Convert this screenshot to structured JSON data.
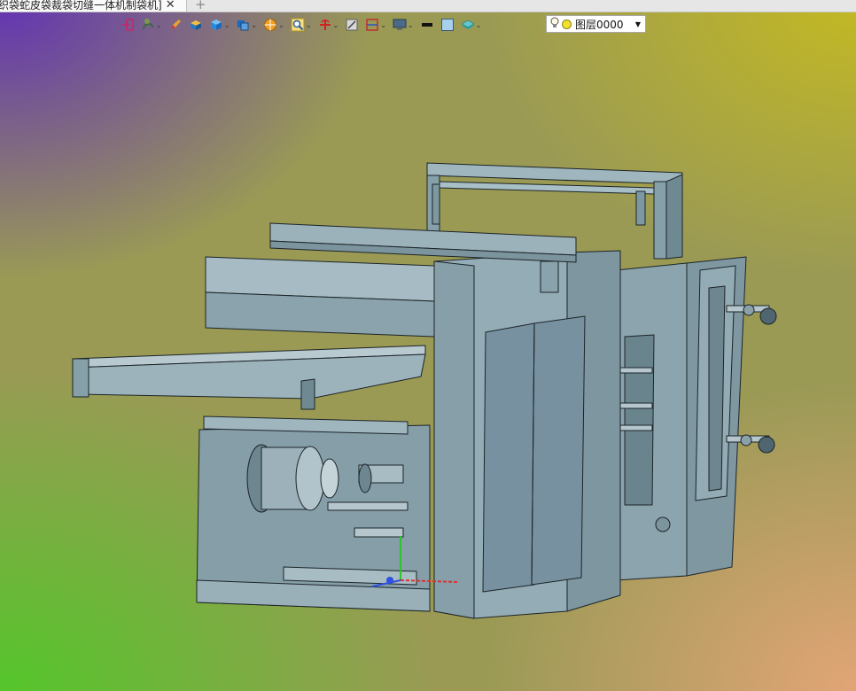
{
  "document_tab": {
    "title": "织袋蛇皮袋裁袋切缝一体机制袋机]",
    "close_symbol": "✕",
    "new_tab_symbol": "+"
  },
  "toolbar": {
    "tools": [
      {
        "icon": "exit-sketch-icon",
        "has_dropdown": false
      },
      {
        "icon": "spiral-curve-icon",
        "has_dropdown": true
      },
      {
        "icon": "pencil-icon",
        "has_dropdown": false
      },
      {
        "icon": "solid-box-icon",
        "has_dropdown": false
      },
      {
        "icon": "cube-icon",
        "has_dropdown": true
      },
      {
        "icon": "view-cube-icon",
        "has_dropdown": true
      },
      {
        "icon": "render-style-icon",
        "has_dropdown": true
      },
      {
        "icon": "zoom-fit-icon",
        "has_dropdown": true
      },
      {
        "icon": "pivot-icon",
        "has_dropdown": true
      },
      {
        "icon": "clip-plane-icon",
        "has_dropdown": false
      },
      {
        "icon": "section-view-icon",
        "has_dropdown": true
      },
      {
        "icon": "display-icon",
        "has_dropdown": true
      },
      {
        "icon": "line-weight-icon",
        "has_dropdown": false
      },
      {
        "icon": "color-swatch-icon",
        "has_dropdown": false
      },
      {
        "icon": "layer-stack-icon",
        "has_dropdown": true
      }
    ],
    "layer_selector": {
      "value": "图层0000",
      "dot_color": "#f1e12a"
    }
  },
  "colors": {
    "machine_face": "#8fa8b2",
    "machine_side": "#7b949e",
    "machine_dark": "#5e7680",
    "edge": "#1c2428",
    "axis_x": "#e03030",
    "axis_y": "#30c030",
    "axis_z": "#3050e0"
  }
}
